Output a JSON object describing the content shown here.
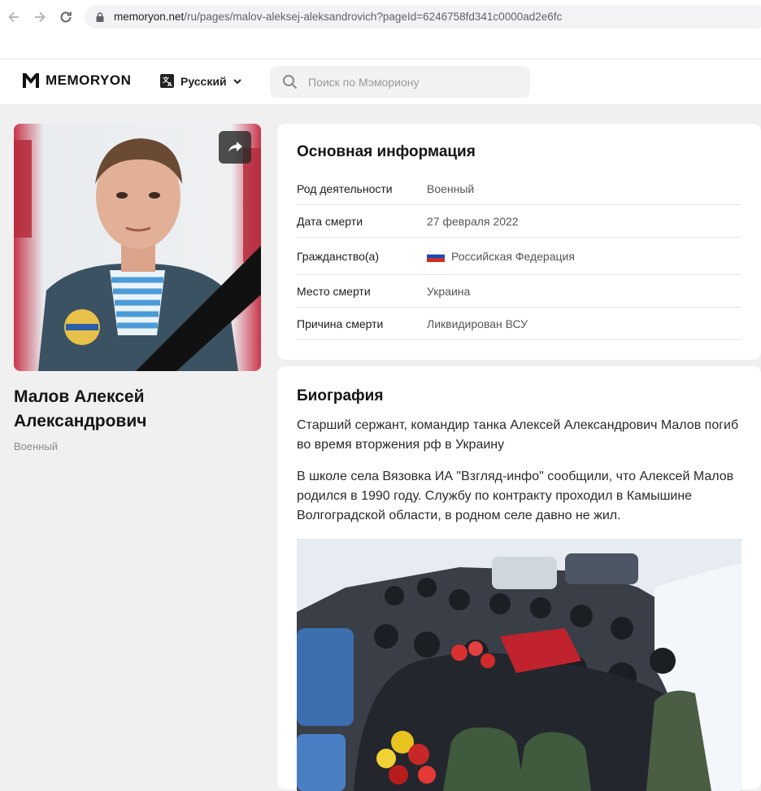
{
  "browser": {
    "url_host": "memoryon.net",
    "url_path": "/ru/pages/malov-aleksej-aleksandrovich?pageId=6246758fd341c0000ad2e6fc"
  },
  "header": {
    "logo_text": "MEMORYON",
    "language": "Русский",
    "search_placeholder": "Поиск по Мэмориону"
  },
  "person": {
    "name": "Малов Алексей Александрович",
    "role": "Военный"
  },
  "info": {
    "title": "Основная информация",
    "rows": [
      {
        "label": "Род деятельности",
        "value": "Военный"
      },
      {
        "label": "Дата смерти",
        "value": "27 февраля 2022"
      },
      {
        "label": "Гражданство(а)",
        "value": "Российская Федерация"
      },
      {
        "label": "Место смерти",
        "value": "Украина"
      },
      {
        "label": "Причина смерти",
        "value": "Ликвидирован ВСУ"
      }
    ]
  },
  "bio": {
    "title": "Биография",
    "paragraphs": [
      "Старший сержант, командир танка Алексей Александрович Малов погиб во время вторжения рф в Украину",
      "В школе села Вязовка ИА \"Взгляд-инфо\" сообщили, что Алексей Малов родился в 1990 году. Службу по контракту проходил в Камышине Волгоградской области, в родном селе давно не жил."
    ]
  },
  "colors": {
    "accent_dark": "#1a1a1a",
    "page_bg": "#f0f0f0",
    "card_bg": "#ffffff"
  },
  "icons": [
    "back-arrow-icon",
    "forward-arrow-icon",
    "reload-icon",
    "lock-icon",
    "memoryon-logo-icon",
    "translate-icon",
    "chevron-down-icon",
    "search-icon",
    "share-icon",
    "russia-flag-icon"
  ]
}
